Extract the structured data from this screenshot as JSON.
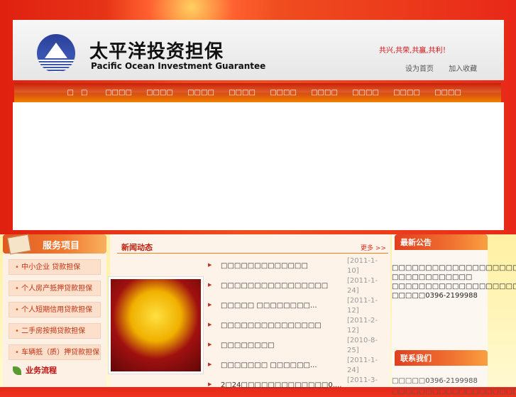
{
  "header": {
    "cn_title": "太平洋投资担保",
    "en_title": "Pacific Ocean Investment Guarantee",
    "slogan": "共兴,共荣,共赢,共利！",
    "links": [
      "设为首页",
      "加入收藏"
    ]
  },
  "nav": [
    "□　□",
    "□□□□",
    "□□□□",
    "□□□□",
    "□□□□",
    "□□□□",
    "□□□□",
    "□□□□",
    "□□□□",
    "□□□□"
  ],
  "services": {
    "title": "服务项目",
    "items": [
      "中小企业  贷款担保",
      "个人房产抵押贷款担保",
      "个人短期信用贷款担保",
      "二手房按揭贷款担保",
      "车辆抵（质）押贷款担保"
    ],
    "flow": "业务流程"
  },
  "news": {
    "title": "新闻动态",
    "more": "更多 >>",
    "items": [
      {
        "title": "□□□□□□□□□□□□□",
        "date": "[2011-1-10]"
      },
      {
        "title": "□□□□□□□□□□□□□□□□",
        "date": "[2011-1-24]"
      },
      {
        "title": "□□□□□ □□□□□□□□...",
        "date": "[2011-1-12]"
      },
      {
        "title": "□□□□□□□□□□□□□□□",
        "date": "[2011-2-12]"
      },
      {
        "title": "□□□□□□□□",
        "date": "[2010-8-25]"
      },
      {
        "title": "□□□□□□□ □□□□□□...",
        "date": "[2011-1-24]"
      },
      {
        "title": "2□24□□□□□□□□□□□□□0....",
        "date": "[2011-3-"
      }
    ]
  },
  "notice": {
    "title": "最新公告",
    "lines": [
      "　　□□□□□□□□□□□□□□□□□□□□",
      "□□□□□□□□□□□□",
      "□□□□□□□□□□□□□□□□□□□□",
      "□□□□□0396-2199988"
    ]
  },
  "contact": {
    "title": "联系我们",
    "lines": [
      "□□□□□0396-2199988",
      "□□□□□□□□□□□□□□□□□□□"
    ]
  }
}
